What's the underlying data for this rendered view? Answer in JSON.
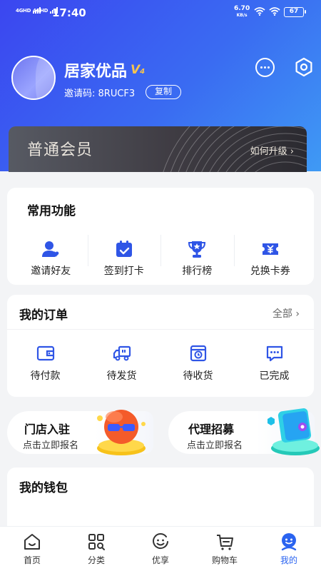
{
  "status_bar": {
    "sim1": "4GHD",
    "sim2": "4GHD",
    "time": "17:40",
    "net_speed": "6.70",
    "net_unit": "KB/s",
    "battery": "67"
  },
  "profile": {
    "shop_name": "居家优品",
    "vip_level": "V",
    "vip_level_num": "4",
    "invite_code_label": "邀请码: 8RUCF3",
    "copy_label": "复制"
  },
  "member": {
    "tier": "普通会员",
    "upgrade_label": "如何升级 ›"
  },
  "common_functions": {
    "title": "常用功能",
    "items": [
      {
        "label": "邀请好友",
        "icon": "invite-user-icon"
      },
      {
        "label": "签到打卡",
        "icon": "calendar-check-icon"
      },
      {
        "label": "排行榜",
        "icon": "trophy-icon"
      },
      {
        "label": "兑换卡券",
        "icon": "coupon-icon"
      }
    ]
  },
  "orders": {
    "title": "我的订单",
    "all_label": "全部 ›",
    "items": [
      {
        "label": "待付款",
        "icon": "wallet-icon"
      },
      {
        "label": "待发货",
        "icon": "truck-icon"
      },
      {
        "label": "待收货",
        "icon": "package-clock-icon"
      },
      {
        "label": "已完成",
        "icon": "chat-dots-icon"
      }
    ]
  },
  "promos": [
    {
      "title": "门店入驻",
      "subtitle": "点击立即报名"
    },
    {
      "title": "代理招募",
      "subtitle": "点击立即报名"
    }
  ],
  "wallet": {
    "title": "我的钱包"
  },
  "tabbar": {
    "active": "我的",
    "items": [
      {
        "label": "首页",
        "icon": "home-icon"
      },
      {
        "label": "分类",
        "icon": "category-icon"
      },
      {
        "label": "优享",
        "icon": "smile-icon"
      },
      {
        "label": "购物车",
        "icon": "cart-icon"
      },
      {
        "label": "我的",
        "icon": "profile-icon"
      }
    ]
  },
  "colors": {
    "brand_blue": "#3b56f2",
    "accent_blue": "#2a63f0",
    "vip_gold": "#f6c44e",
    "member_dark": "#3f3c43"
  }
}
